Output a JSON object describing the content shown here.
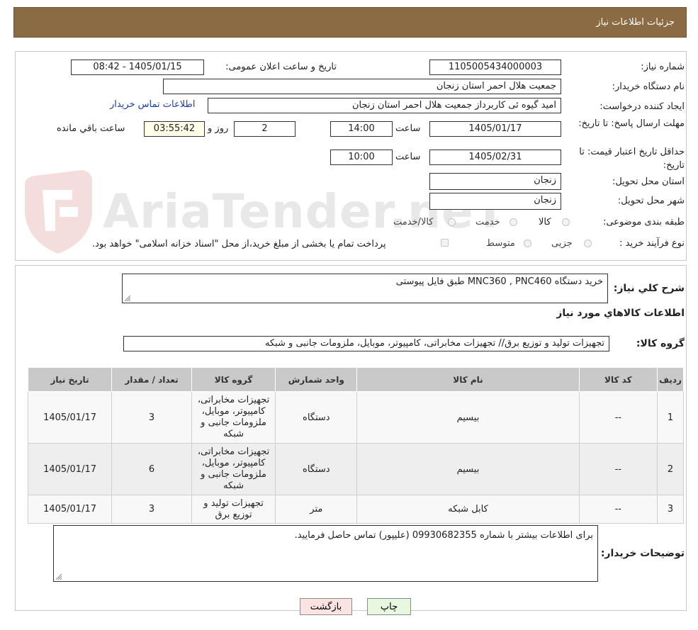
{
  "header": {
    "title": "جزئیات اطلاعات نیاز"
  },
  "form": {
    "need_number_label": "شماره نیاز:",
    "need_number": "1105005434000003",
    "announce_label": "تاریخ و ساعت اعلان عمومی:",
    "announce_value": "1405/01/15 - 08:42",
    "buyer_org_label": "نام دستگاه خریدار:",
    "buyer_org": "جمعیت هلال احمر استان زنجان",
    "creator_label": "ایجاد کننده درخواست:",
    "creator": "امید گیوه ئی کاربرداز  جمعیت هلال احمر استان زنجان",
    "contact_link": "اطلاعات تماس خریدار",
    "deadline_label": "مهلت ارسال پاسخ: تا تاریخ:",
    "deadline_date": "1405/01/17",
    "hour_label": "ساعت",
    "deadline_time": "14:00",
    "days_value": "2",
    "days_label": "روز و",
    "remaining_time": "03:55:42",
    "remaining_label": "ساعت باقي مانده",
    "validity_label": "حداقل تاریخ اعتبار قیمت: تا تاریخ:",
    "validity_date": "1405/02/31",
    "validity_time": "10:00",
    "province_label": "استان محل تحویل:",
    "province": "زنجان",
    "city_label": "شهر محل تحویل:",
    "city": "زنجان",
    "category_label": "طبقه بندی موضوعی:",
    "category_options": [
      "کالا",
      "خدمت",
      "کالا/خدمت"
    ],
    "process_label": "نوع فرآیند خرید :",
    "process_options": [
      "جزیی",
      "متوسط"
    ],
    "treasury_note": "پرداخت تمام یا بخشی از مبلغ خرید،از محل \"اسناد خزانه اسلامی\" خواهد بود."
  },
  "summary": {
    "description_label": "شرح كلي نياز:",
    "description": "خرید دستگاه MNC360 , PNC460 طبق فایل پیوستی",
    "goods_info_title": "اطلاعات كالاهاي مورد نياز",
    "goods_group_label": "گروه كالا:",
    "goods_group": "تجهیزات تولید و توزیع برق// تجهیزات مخابراتی، کامپیوتر، موبایل، ملزومات جانبی و شبکه"
  },
  "table": {
    "headers": [
      "رديف",
      "کد کالا",
      "نام کالا",
      "واحد شمارش",
      "گروه کالا",
      "تعداد / مقدار",
      "تاریخ نیاز"
    ],
    "rows": [
      [
        "1",
        "--",
        "بیسیم",
        "دستگاه",
        "تجهیزات مخابراتی، کامپیوتر، موبایل، ملزومات جانبی و شبکه",
        "3",
        "1405/01/17"
      ],
      [
        "2",
        "--",
        "بیسیم",
        "دستگاه",
        "تجهیزات مخابراتی، کامپیوتر، موبایل، ملزومات جانبی و شبکه",
        "6",
        "1405/01/17"
      ],
      [
        "3",
        "--",
        "کابل شبکه",
        "متر",
        "تجهیزات تولید و توزیع برق",
        "3",
        "1405/01/17"
      ]
    ]
  },
  "buyer_notes": {
    "label": "توضیحات خریدار:",
    "text": "برای اطلاعات بیشتر با شماره 09930682355  (علیپور) تماس حاصل فرمایید."
  },
  "buttons": {
    "print": "چاپ",
    "back": "بازگشت"
  },
  "watermark": {
    "text": "AriaTender.neT"
  },
  "colors": {
    "header_bg": "#8B6B43",
    "link": "#1a3fa8",
    "print_btn": "#e8f7e0",
    "back_btn": "#fbe3e3"
  }
}
